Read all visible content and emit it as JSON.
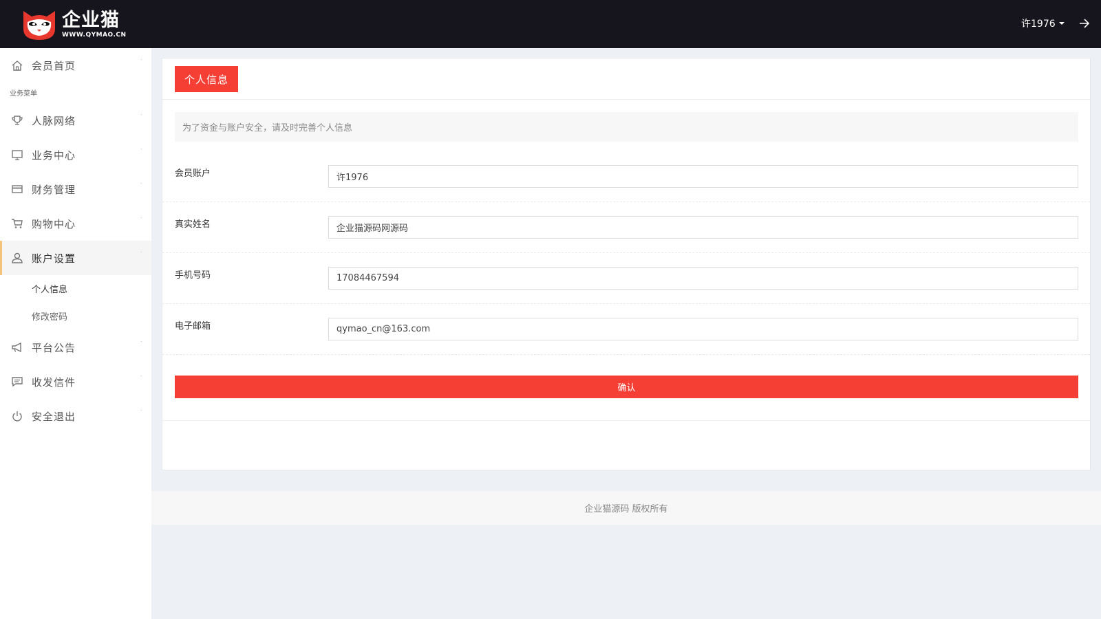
{
  "header": {
    "logo_title": "企业猫",
    "logo_url": "WWW.QYMAO.CN",
    "username": "许1976"
  },
  "sidebar": {
    "section_label": "业务菜单",
    "items": [
      {
        "label": "会员首页",
        "icon": "home-icon"
      },
      {
        "label": "人脉网络",
        "icon": "trophy-icon"
      },
      {
        "label": "业务中心",
        "icon": "monitor-icon"
      },
      {
        "label": "财务管理",
        "icon": "card-icon"
      },
      {
        "label": "购物中心",
        "icon": "cart-icon"
      },
      {
        "label": "账户设置",
        "icon": "user-icon",
        "active": true,
        "children": [
          "个人信息",
          "修改密码"
        ]
      },
      {
        "label": "平台公告",
        "icon": "megaphone-icon"
      },
      {
        "label": "收发信件",
        "icon": "message-icon"
      },
      {
        "label": "安全退出",
        "icon": "power-icon"
      }
    ]
  },
  "panel": {
    "tab_label": "个人信息",
    "notice": "为了资金与账户安全，请及时完善个人信息",
    "fields": [
      {
        "label": "会员账户",
        "value": "许1976"
      },
      {
        "label": "真实姓名",
        "value": "企业猫源码网源码"
      },
      {
        "label": "手机号码",
        "value": "17084467594"
      },
      {
        "label": "电子邮箱",
        "value": "qymao_cn@163.com"
      }
    ],
    "confirm_label": "确认"
  },
  "footer": {
    "copyright": "企业猫源码 版权所有"
  },
  "colors": {
    "header_bg": "#16141c",
    "accent_red": "#f53f35",
    "active_border": "#f4c47a",
    "page_bg": "#edf0f4"
  }
}
